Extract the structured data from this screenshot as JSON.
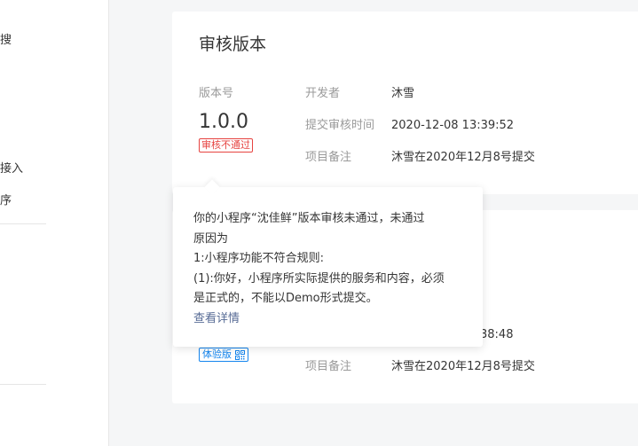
{
  "sidebar": {
    "fragments": [
      "搜",
      "接入",
      "序"
    ]
  },
  "review_card": {
    "title": "审核版本",
    "version_label": "版本号",
    "version": "1.0.0",
    "status_badge": "审核不通过",
    "developer_label": "开发者",
    "developer": "沐雪",
    "submit_time_label": "提交审核时间",
    "submit_time": "2020-12-08 13:39:52",
    "remark_label": "项目备注",
    "remark": "沐雪在2020年12月8号提交"
  },
  "trial_card": {
    "badge": "体验版",
    "submit_time_partial": "38:48",
    "remark_label": "项目备注",
    "remark": "沐雪在2020年12月8号提交"
  },
  "popover": {
    "line1": "你的小程序“沈佳鲜”版本审核未通过，未通过",
    "line2": "原因为",
    "line3": "1:小程序功能不符合规则:",
    "line4": "(1):你好，小程序所实际提供的服务和内容，必须",
    "line5": "是正式的，不能以Demo形式提交。",
    "link": "查看详情"
  },
  "colors": {
    "reject": "#e64340",
    "trial": "#1485ee",
    "link": "#576b95"
  }
}
